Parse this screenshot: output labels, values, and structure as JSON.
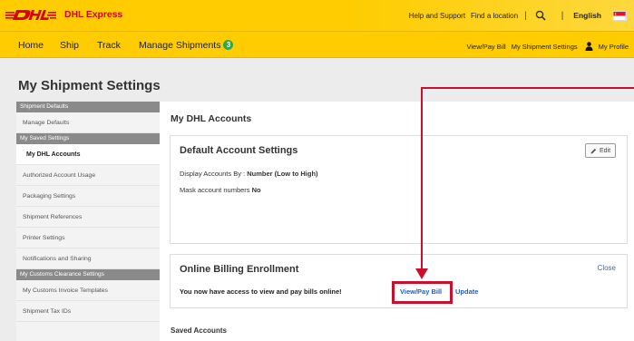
{
  "header": {
    "brand_logo_text": "DHL",
    "brand_name": "DHL Express",
    "help_link": "Help and Support",
    "find_location_link": "Find a location",
    "separator": "|",
    "search_icon": "search-icon",
    "language": "English",
    "flag_icon": "singapore-flag-icon"
  },
  "nav": {
    "items": [
      "Home",
      "Ship",
      "Track",
      "Manage Shipments"
    ],
    "manage_badge": "3",
    "right_links": [
      "View/Pay Bill",
      "My Shipment Settings",
      "My Profile"
    ],
    "profile_icon": "person-icon"
  },
  "page": {
    "title": "My Shipment Settings"
  },
  "sidebar": {
    "sections": [
      {
        "heading": "Shipment Defaults",
        "items": [
          "Manage Defaults"
        ]
      },
      {
        "heading": "My Saved Settings",
        "items": [
          "My DHL Accounts",
          "Authorized Account Usage",
          "Packaging Settings",
          "Shipment References",
          "Printer Settings",
          "Notifications and Sharing"
        ]
      },
      {
        "heading": "My Customs Clearance Settings",
        "items": [
          "My Customs Invoice Templates",
          "Shipment Tax IDs"
        ]
      }
    ],
    "active_item": "My DHL Accounts"
  },
  "content": {
    "section_title": "My DHL Accounts",
    "default_settings": {
      "title": "Default Account Settings",
      "edit_label": "Edit",
      "display_label": "Display Accounts By :",
      "display_value": "Number (Low to High)",
      "mask_label": "Mask account numbers",
      "mask_value": "No"
    },
    "billing": {
      "title": "Online Billing Enrollment",
      "close_label": "Close",
      "message": "You now have access to view and pay bills online!",
      "pay_link": "View/Pay Bill",
      "update_link": "Update"
    },
    "saved_accounts_title": "Saved Accounts"
  },
  "colors": {
    "dhl_yellow": "#fecc00",
    "dhl_red": "#d40511",
    "link_blue": "#1f5fbf",
    "annotation_red": "#c8102e"
  }
}
